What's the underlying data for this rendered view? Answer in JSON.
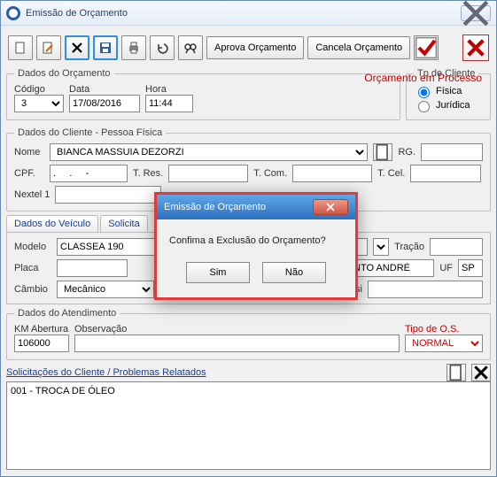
{
  "window": {
    "title": "Emissão de Orçamento"
  },
  "toolbar": {
    "approve": "Aprova Orçamento",
    "cancel": "Cancela Orçamento"
  },
  "status_text": "Orçamento em Processo",
  "dados_orc": {
    "legend": "Dados do Orçamento",
    "codigo_label": "Código",
    "codigo": "3",
    "data_label": "Data",
    "data": "17/08/2016",
    "hora_label": "Hora",
    "hora": "11:44"
  },
  "tp_cliente": {
    "legend": "Tp de Cliente",
    "fisica": "Física",
    "juridica": "Jurídica"
  },
  "cliente": {
    "legend": "Dados do Cliente  -  Pessoa Física",
    "nome_label": "Nome",
    "nome": "BIANCA MASSUIA DEZORZI",
    "rg_label": "RG.",
    "rg": "",
    "cpf_label": "CPF.",
    "cpf": ".     .     -",
    "tres_label": "T. Res.",
    "tcom_label": "T. Com.",
    "tcel_label": "T. Cel.",
    "tcel": "",
    "nextel_label": "Nextel 1"
  },
  "tabs": {
    "veiculo": "Dados do Veículo",
    "solicit": "Solicita"
  },
  "veiculo": {
    "modelo_label": "Modelo",
    "modelo": "CLASSEA 190",
    "tracao_label": "Tração",
    "tracao": "",
    "placa_label": "Placa",
    "placa": "",
    "cidade": "SANTO ANDRÉ",
    "uf_label": "UF",
    "uf": "SP",
    "cambio_label": "Câmbio",
    "cambio": "Mecânico",
    "chassi_label": "Chassi",
    "chassi": ""
  },
  "atend": {
    "legend": "Dados do Atendimento",
    "km_label": "KM Abertura",
    "km": "106000",
    "obs_label": "Observação",
    "obs": "",
    "tipo_label": "Tipo de O.S.",
    "tipo": "NORMAL"
  },
  "sol": {
    "label": "Solicitações do Cliente / Problemas Relatados",
    "text": "001 - TROCA DE ÓLEO"
  },
  "modal": {
    "title": "Emissão de Orçamento",
    "msg": "Confima a Exclusão do Orçamento?",
    "yes": "Sim",
    "no": "Não"
  }
}
